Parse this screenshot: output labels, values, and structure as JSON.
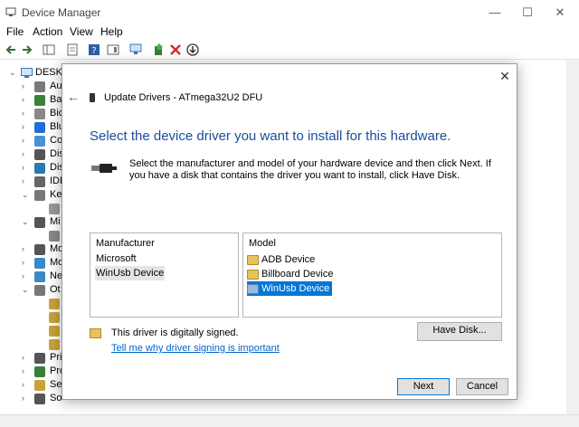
{
  "window": {
    "title": "Device Manager",
    "menu": [
      "File",
      "Action",
      "View",
      "Help"
    ],
    "controls": {
      "minimize": "—",
      "maximize": "☐",
      "close": "✕"
    }
  },
  "tree": {
    "root": "DESKT",
    "items": [
      {
        "label": "Au",
        "icon": "audio-icon",
        "color": "#7a7a7a"
      },
      {
        "label": "Ba",
        "icon": "battery-icon",
        "color": "#3a7f3a"
      },
      {
        "label": "Bio",
        "icon": "biometric-icon",
        "color": "#888888"
      },
      {
        "label": "Blu",
        "icon": "bluetooth-icon",
        "color": "#1e6fd9"
      },
      {
        "label": "Co",
        "icon": "computer-icon",
        "color": "#4a90d9"
      },
      {
        "label": "Dis",
        "icon": "disk-icon",
        "color": "#555555"
      },
      {
        "label": "Dis",
        "icon": "display-icon",
        "color": "#2a7ab0"
      },
      {
        "label": "IDE",
        "icon": "ide-icon",
        "color": "#666666"
      },
      {
        "label": "Ke",
        "icon": "keyboard-icon",
        "color": "#777777"
      },
      {
        "label": "",
        "icon": "keyboard-sub-icon",
        "color": "#999999"
      },
      {
        "label": "Mi",
        "icon": "mouse-icon",
        "color": "#555555"
      },
      {
        "label": "",
        "icon": "mouse-sub-icon",
        "color": "#888888"
      },
      {
        "label": "Mo",
        "icon": "modem-icon",
        "color": "#555555"
      },
      {
        "label": "Mo",
        "icon": "monitor-icon",
        "color": "#3a88c8"
      },
      {
        "label": "Ne",
        "icon": "network-icon",
        "color": "#3a88c8"
      },
      {
        "label": "Ot",
        "icon": "other-devices-icon",
        "color": "#777777"
      },
      {
        "label": "",
        "icon": "unknown-device-icon",
        "color": "#c8a23a"
      },
      {
        "label": "",
        "icon": "unknown-device-icon",
        "color": "#c8a23a"
      },
      {
        "label": "",
        "icon": "unknown-device-icon",
        "color": "#c8a23a"
      },
      {
        "label": "",
        "icon": "unknown-device-icon",
        "color": "#c8a23a"
      },
      {
        "label": "Pri",
        "icon": "print-queue-icon",
        "color": "#555555"
      },
      {
        "label": "Pro",
        "icon": "processor-icon",
        "color": "#3a7f3a"
      },
      {
        "label": "Se",
        "icon": "security-icon",
        "color": "#c8a23a"
      },
      {
        "label": "So",
        "icon": "software-icon",
        "color": "#555555"
      }
    ]
  },
  "dialog": {
    "title": "Update Drivers - ATmega32U2 DFU",
    "heading": "Select the device driver you want to install for this hardware.",
    "description": "Select the manufacturer and model of your hardware device and then click Next. If you have a disk that contains the driver you want to install, click Have Disk.",
    "manufacturer_header": "Manufacturer",
    "manufacturers": [
      "Microsoft",
      "WinUsb Device"
    ],
    "manufacturer_selected": 1,
    "model_header": "Model",
    "models": [
      "ADB Device",
      "Billboard Device",
      "WinUsb Device"
    ],
    "model_selected": 2,
    "signed_text": "This driver is digitally signed.",
    "signing_link": "Tell me why driver signing is important",
    "have_disk_label": "Have Disk...",
    "next_label": "Next",
    "cancel_label": "Cancel",
    "close_glyph": "✕",
    "back_glyph": "←"
  },
  "colors": {
    "heading": "#1a4d9a",
    "selection": "#0078d7",
    "link": "#0066cc"
  }
}
